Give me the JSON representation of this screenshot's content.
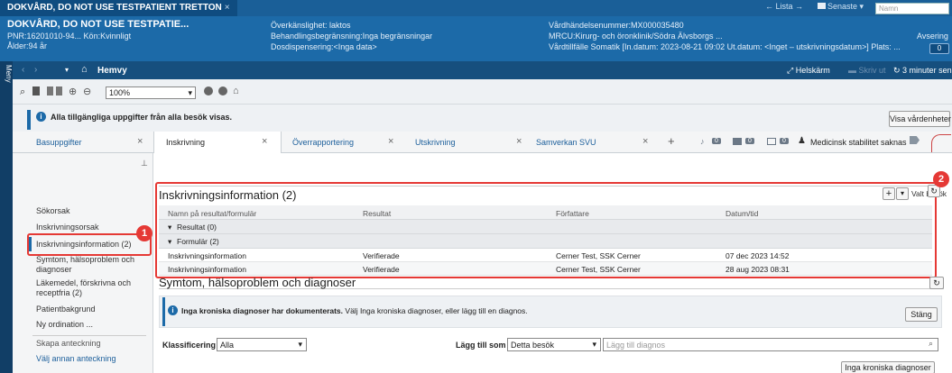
{
  "patient_tab": {
    "title": "DOKVÅRD, DO NOT USE TESTPATIENT TRETTON",
    "close": "×"
  },
  "topnav": {
    "lista": "← Lista →",
    "senaste": "Senaste ▾",
    "search_placeholder": "Namn"
  },
  "patient": {
    "name": "DOKVÅRD, DO NOT USE TESTPATIE...",
    "pnr": "PNR:16201010-94... Kön:Kvinnligt",
    "age": "Ålder:94 år",
    "allergy": "Överkänslighet: laktos",
    "treatment_limit": "Behandlingsbegränsning:Inga begränsningar",
    "dose": "Dosdispensering:<Inga data>",
    "encounter": "Vårdhändelsenummer:MX000035480",
    "unit": "MRCU:Kirurg- och öronklinik/Södra Älvsborgs ...",
    "stay": "Vårdtillfälle Somatik [In.datum: 2023-08-21 09:02 Ut.datum: <Inget – utskrivningsdatum>] Plats: ...",
    "avsering": "Avsering",
    "avsering_count": "0"
  },
  "navbar": {
    "meny": "Meny",
    "home": "Hemvy",
    "fullscreen": "Helskärm",
    "print": "Skriv ut",
    "refresh": "3 minuter sen"
  },
  "toolbar": {
    "zoom": "100%"
  },
  "info": {
    "message": "Alla tillgängliga uppgifter från alla besök visas.",
    "button": "Visa vårdenheter"
  },
  "tabs": {
    "basuppgifter": "Basuppgifter",
    "items": [
      "Inskrivning",
      "Överrapportering",
      "Utskrivning",
      "Samverkan SVU"
    ],
    "add": "+",
    "counts": [
      "0",
      "0",
      "0"
    ],
    "status": "Medicinsk stabilitet saknas"
  },
  "sidebar": {
    "items": [
      "Sökorsak",
      "Inskrivningsorsak",
      "Inskrivningsinformation (2)",
      "Symtom, hälsoproblem och diagnoser",
      "Läkemedel, förskrivna och receptfria (2)",
      "Patientbakgrund",
      "Ny ordination ..."
    ],
    "note_header": "Skapa anteckning",
    "note_link": "Välj annan anteckning"
  },
  "section1": {
    "title": "Inskrivningsinformation",
    "count": "(2)",
    "filter": "Valt besök",
    "columns": [
      "Namn på resultat/formulär",
      "Resultat",
      "Författare",
      "Datum/tid"
    ],
    "groups": [
      "Resultat (0)",
      "Formulär (2)"
    ],
    "rows": [
      [
        "Inskrivningsinformation",
        "Verifierade",
        "Cerner Test, SSK Cerner",
        "07 dec 2023 14:52"
      ],
      [
        "Inskrivningsinformation",
        "Verifierade",
        "Cerner Test, SSK Cerner",
        "28 aug 2023 08:31"
      ]
    ]
  },
  "section2": {
    "title": "Symtom, hälsoproblem och diagnoser",
    "notice_bold": "Inga kroniska diagnoser har dokumenterats.",
    "notice_rest": "Välj Inga kroniska diagnoser, eller lägg till en diagnos.",
    "close": "Stäng",
    "klass_label": "Klassificering",
    "klass_value": "Alla",
    "add_label": "Lägg till som",
    "add_value": "Detta besök",
    "diag_placeholder": "Lägg till diagnos",
    "no_chronic_button": "Inga kroniska diagnoser"
  },
  "callouts": [
    "1",
    "2"
  ],
  "colors": {
    "banner": "#1c6aa8",
    "highlight": "#e53935"
  }
}
